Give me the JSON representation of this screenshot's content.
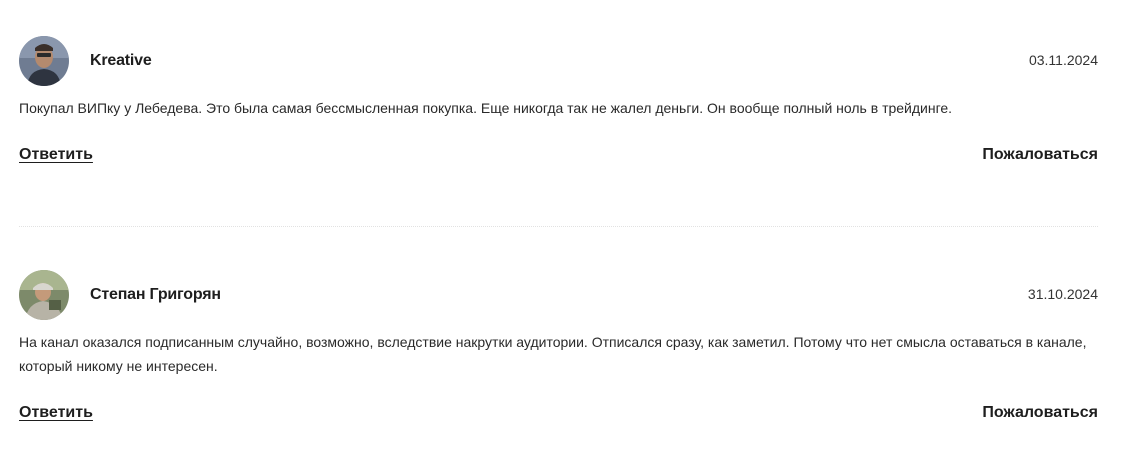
{
  "comments": [
    {
      "author": "Kreative",
      "date": "03.11.2024",
      "text": "Покупал ВИПку у Лебедева. Это была самая бессмысленная покупка. Еще никогда так не жалел деньги. Он вообще полный ноль в трейдинге.",
      "reply_label": "Ответить",
      "report_label": "Пожаловаться"
    },
    {
      "author": "Степан Григорян",
      "date": "31.10.2024",
      "text": "На канал оказался подписанным случайно, возможно, вследствие накрутки аудитории. Отписался сразу, как заметил. Потому что нет смысла оставаться в канале, который никому не интересен.",
      "reply_label": "Ответить",
      "report_label": "Пожаловаться"
    }
  ],
  "colors": {
    "text": "#222222",
    "divider": "#e2e2e2",
    "background": "#ffffff"
  }
}
